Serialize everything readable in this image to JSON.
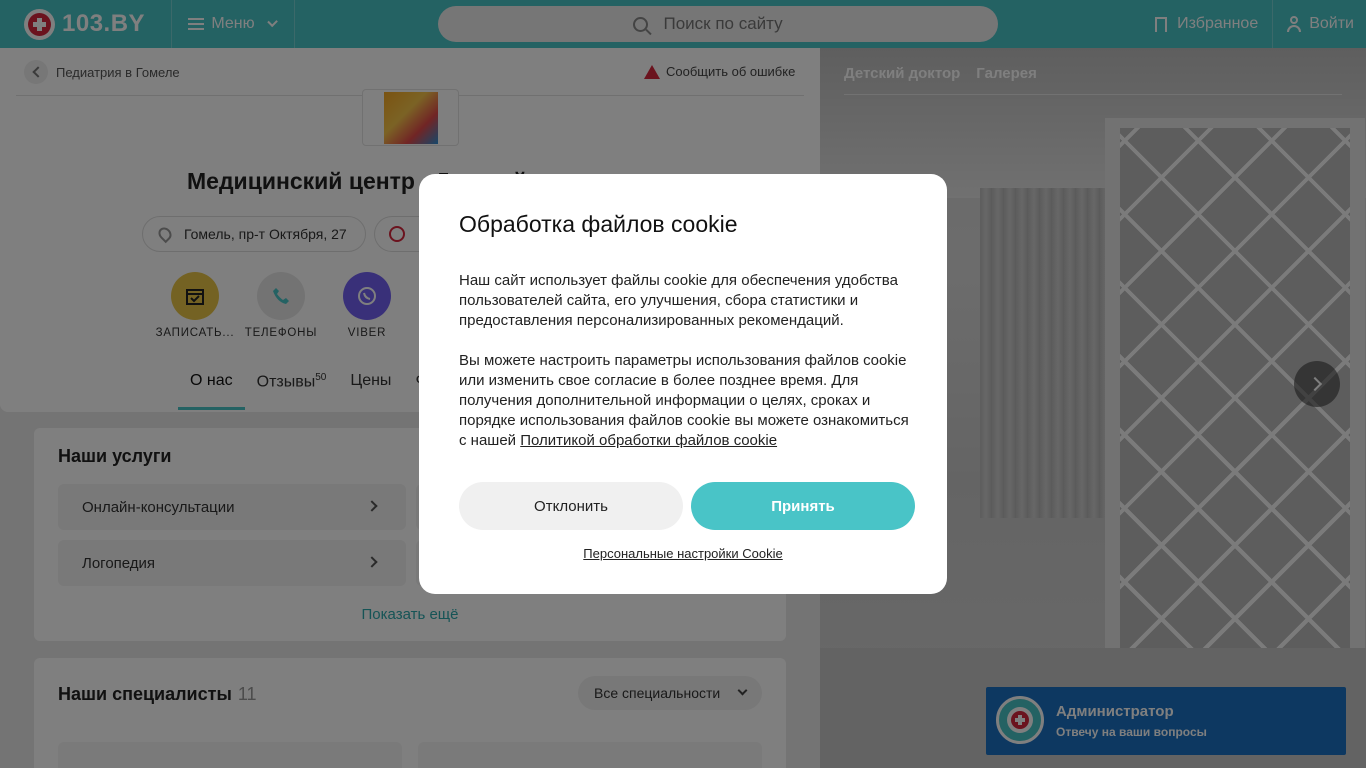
{
  "header": {
    "logo_text": "103.BY",
    "menu_label": "Меню",
    "search_placeholder": "Поиск по сайту",
    "favorites_label": "Избранное",
    "login_label": "Войти"
  },
  "breadcrumb": {
    "label": "Педиатрия в Гомеле"
  },
  "report_label": "Сообщить об ошибке",
  "clinic": {
    "title": "Медицинский центр «Детский доктор»",
    "address": "Гомель, пр-т Октября, 27"
  },
  "actions": [
    {
      "label": "ЗАПИСАТЬ...",
      "icon": "calendar-check-icon",
      "color": "#e8c547"
    },
    {
      "label": "ТЕЛЕФОНЫ",
      "icon": "phone-icon",
      "color": "#e6e6e6"
    },
    {
      "label": "VIBER",
      "icon": "viber-icon",
      "color": "#7360f2"
    }
  ],
  "tabs": [
    {
      "label": "О нас",
      "badge": ""
    },
    {
      "label": "Отзывы",
      "badge": "50"
    },
    {
      "label": "Цены",
      "badge": ""
    },
    {
      "label": "Ф",
      "badge": ""
    }
  ],
  "services": {
    "title": "Наши услуги",
    "items": [
      "Онлайн-консультации",
      "Логопедия"
    ],
    "show_more": "Показать ещё"
  },
  "specialists": {
    "title": "Наши специалисты",
    "count": "11",
    "filter_label": "Все специальности"
  },
  "gallery": {
    "tabs": [
      "Детский доктор",
      "Галерея"
    ]
  },
  "admin_widget": {
    "name": "Администратор",
    "subtitle": "Отвечу на ваши вопросы"
  },
  "cookie_modal": {
    "title": "Обработка файлов cookie",
    "paragraph1": "Наш сайт использует файлы cookie для обеспечения удобства пользователей сайта, его улучшения, сбора статистики и предоставления персонализированных рекомендаций.",
    "paragraph2": "Вы можете настроить параметры использования файлов cookie или изменить свое согласие в более позднее время. Для получения дополнительной информации о целях, сроках и порядке использования файлов cookie вы можете ознакомиться с нашей",
    "policy_link": "Политикой обработки файлов cookie",
    "decline_label": "Отклонить",
    "accept_label": "Принять",
    "settings_link": "Персональные настройки Cookie"
  },
  "colors": {
    "accent": "#49c4c7",
    "brand_red": "#d7263d",
    "admin_blue": "#1a70c2"
  }
}
